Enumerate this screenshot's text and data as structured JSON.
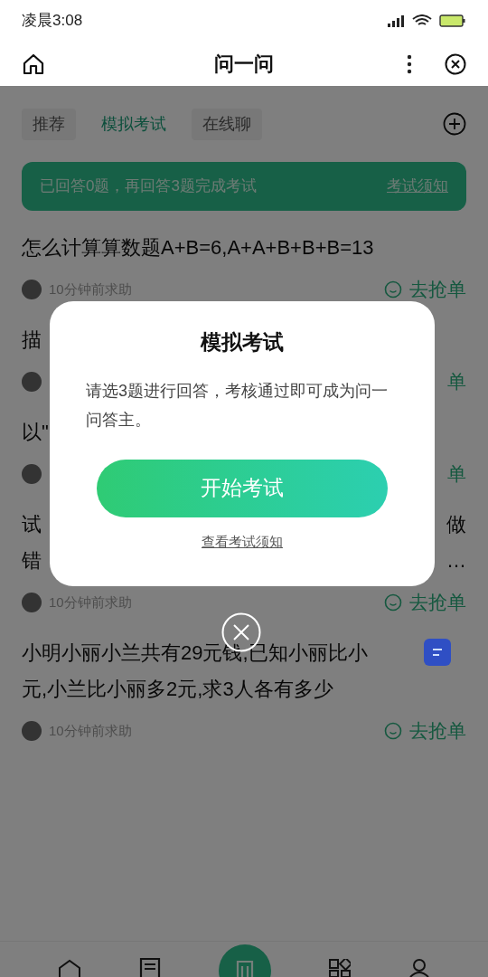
{
  "status_bar": {
    "time": "凌晨3:08"
  },
  "header": {
    "title": "问一问"
  },
  "tabs": [
    {
      "label": "推荐",
      "selected": false
    },
    {
      "label": "模拟考试",
      "selected": true
    },
    {
      "label": "在线聊",
      "selected": false
    }
  ],
  "banner": {
    "text": "已回答0题，再回答3题完成考试",
    "link": "考试须知"
  },
  "questions": [
    {
      "lines": [
        {
          "left": "怎么计算算数题A+B=6,A+A+B+B+B=13"
        }
      ],
      "meta": "10分钟前求助",
      "action": "去抢单",
      "action_icon": true
    },
    {
      "lines": [
        {
          "left": "描"
        }
      ],
      "action": "单",
      "action_icon": false
    },
    {
      "lines": [
        {
          "left": "以\""
        }
      ],
      "action": "单",
      "action_icon": false
    },
    {
      "lines": [
        {
          "left": "试",
          "right": "做"
        },
        {
          "left": "错",
          "right": "…"
        }
      ],
      "meta": "10分钟前求助",
      "action": "去抢单",
      "action_icon": true
    },
    {
      "lines": [
        {
          "left": "小明小丽小兰共有29元钱,已知小丽比小"
        },
        {
          "left": "元,小兰比小丽多2元,求3人各有多少"
        }
      ],
      "meta": "10分钟前求助",
      "action": "去抢单",
      "action_icon": true
    }
  ],
  "modal": {
    "title": "模拟考试",
    "message": "请选3题进行回答，考核通过即可成为问一问答主。",
    "button": "开始考试",
    "link": "查看考试须知"
  }
}
